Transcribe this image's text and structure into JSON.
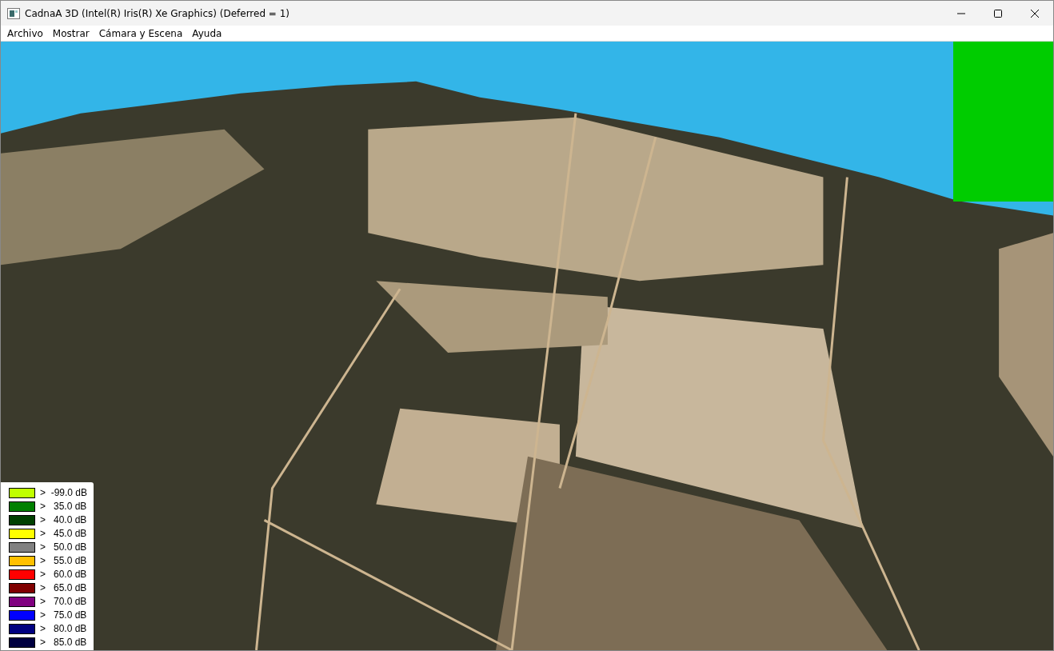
{
  "window": {
    "title": "CadnaA 3D (Intel(R) Iris(R) Xe Graphics) (Deferred = 1)"
  },
  "menu": [
    "Archivo",
    "Mostrar",
    "Cámara y Escena",
    "Ayuda"
  ],
  "legend": [
    {
      "label": ">  -99.0 dB",
      "color": "#c0ff00"
    },
    {
      "label": ">   35.0 dB",
      "color": "#008000"
    },
    {
      "label": ">   40.0 dB",
      "color": "#004000"
    },
    {
      "label": ">   45.0 dB",
      "color": "#ffff00"
    },
    {
      "label": ">   50.0 dB",
      "color": "#808080"
    },
    {
      "label": ">   55.0 dB",
      "color": "#ffc000"
    },
    {
      "label": ">   60.0 dB",
      "color": "#ff0000"
    },
    {
      "label": ">   65.0 dB",
      "color": "#800000"
    },
    {
      "label": ">   70.0 dB",
      "color": "#800080"
    },
    {
      "label": ">   75.0 dB",
      "color": "#0000ff"
    },
    {
      "label": ">   80.0 dB",
      "color": "#000080"
    },
    {
      "label": ">   85.0 dB",
      "color": "#000040"
    }
  ]
}
